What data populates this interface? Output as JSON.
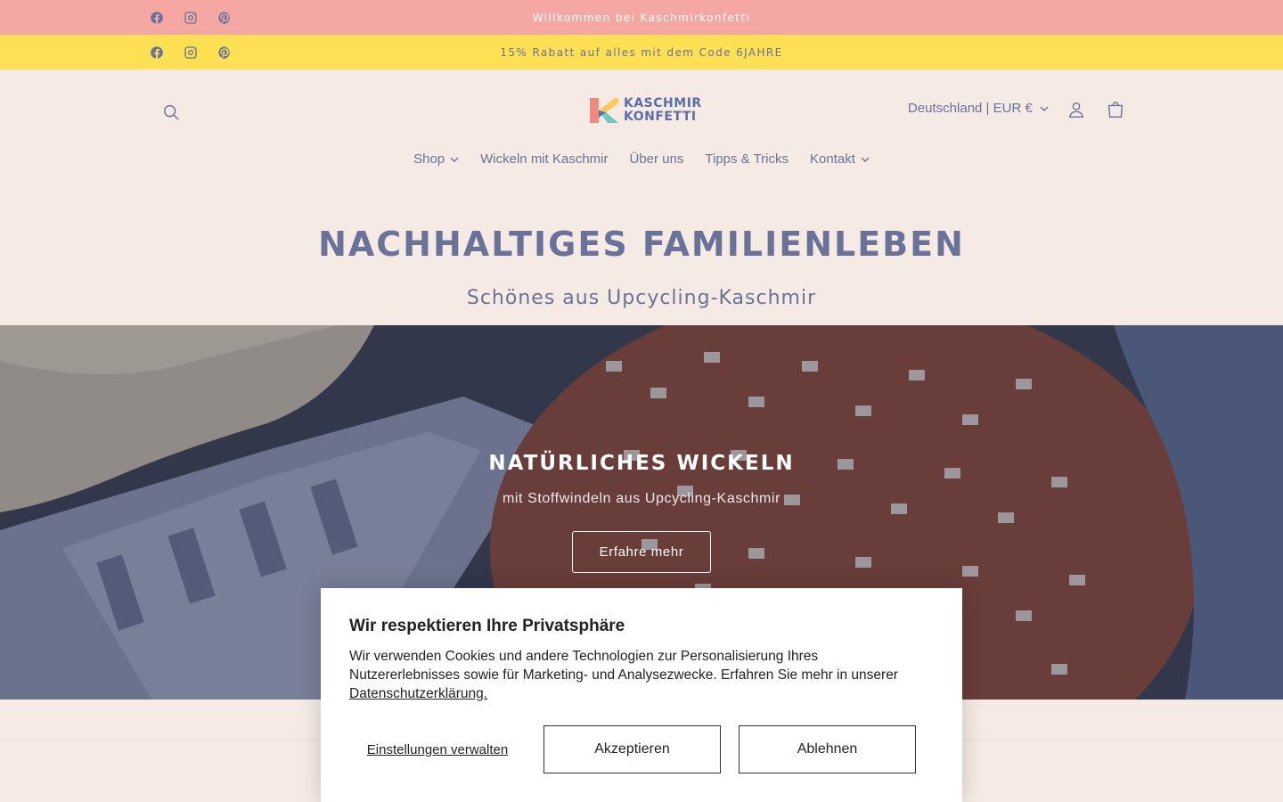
{
  "announcements": {
    "top": "Willkommen bei Kaschmirkonfetti",
    "promo": "15% Rabatt auf alles mit dem Code 6JAHRE"
  },
  "social_icons": [
    "facebook-icon",
    "instagram-icon",
    "pinterest-icon"
  ],
  "header": {
    "logo_line1": "KASCHMIR",
    "logo_line2": "KONFETTI",
    "locale": "Deutschland | EUR €"
  },
  "nav": {
    "items": [
      {
        "label": "Shop",
        "has_dropdown": true
      },
      {
        "label": "Wickeln mit Kaschmir",
        "has_dropdown": false
      },
      {
        "label": "Über uns",
        "has_dropdown": false
      },
      {
        "label": "Tipps & Tricks",
        "has_dropdown": false
      },
      {
        "label": "Kontakt",
        "has_dropdown": true
      }
    ]
  },
  "hero": {
    "title": "NACHHALTIGES FAMILIENLEBEN",
    "subtitle": "Schönes aus Upcycling-Kaschmir"
  },
  "banner": {
    "title": "NATÜRLICHES WICKELN",
    "subtitle": "mit Stoffwindeln aus Upcycling-Kaschmir",
    "button": "Erfahre mehr"
  },
  "cookie": {
    "title": "Wir respektieren Ihre Privatsphäre",
    "text": "Wir verwenden Cookies und andere Technologien zur Personalisierung Ihres Nutzererlebnisses sowie für Marketing- und Analysezwecke. Erfahren Sie mehr in unserer ",
    "link": "Datenschutzerklärung.",
    "manage": "Einstellungen verwalten",
    "accept": "Akzeptieren",
    "reject": "Ablehnen"
  },
  "colors": {
    "pink_bar": "#f4a7a3",
    "yellow_bar": "#fde054",
    "accent_text": "#6a7299",
    "page_bg": "#f5ebe4"
  }
}
